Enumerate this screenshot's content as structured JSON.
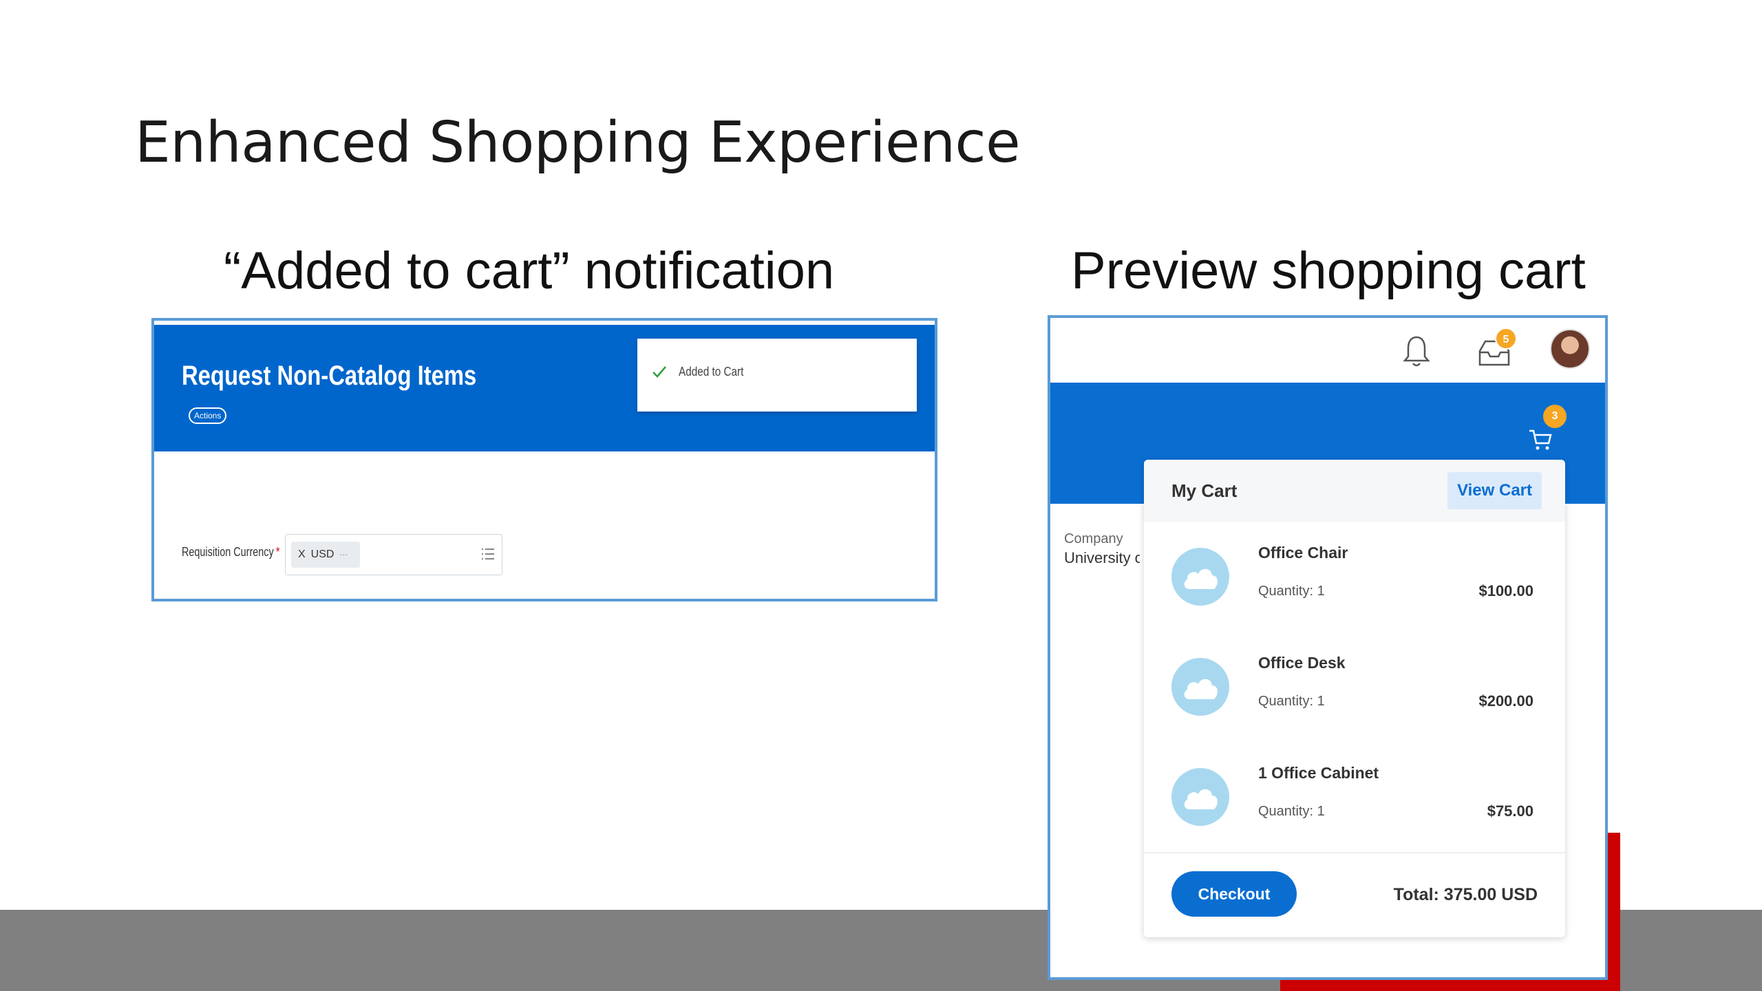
{
  "slide": {
    "title": "Enhanced Shopping Experience",
    "left_section_title": "“Added to cart” notification",
    "right_section_title": "Preview shopping cart"
  },
  "left_panel": {
    "page_title": "Request Non-Catalog Items",
    "actions_label": "Actions",
    "toast_text": "Added to Cart",
    "field_label": "Requisition Currency",
    "required_marker": "*",
    "currency_chip": {
      "remove": "X",
      "value": "USD",
      "more": "⋯"
    }
  },
  "right_panel": {
    "inbox_badge": "5",
    "cart_badge": "3",
    "company_label": "Company",
    "company_value": "University of",
    "cart": {
      "title": "My Cart",
      "view_cart_label": "View Cart",
      "items": [
        {
          "name": "Office Chair",
          "quantity": "Quantity: 1",
          "price": "$100.00"
        },
        {
          "name": "Office Desk",
          "quantity": "Quantity: 1",
          "price": "$200.00"
        },
        {
          "name": "1 Office Cabinet",
          "quantity": "Quantity: 1",
          "price": "$75.00"
        }
      ],
      "checkout_label": "Checkout",
      "total": "Total: 375.00 USD"
    }
  },
  "colors": {
    "brand_blue": "#0066cc",
    "cart_blue": "#0a6ed1",
    "badge_orange": "#f5a623",
    "accent_red": "#cc0000",
    "bottom_gray": "#808080"
  },
  "icons": [
    "check-icon",
    "list-icon",
    "bell-icon",
    "inbox-icon",
    "cart-icon",
    "cloud-icon"
  ]
}
